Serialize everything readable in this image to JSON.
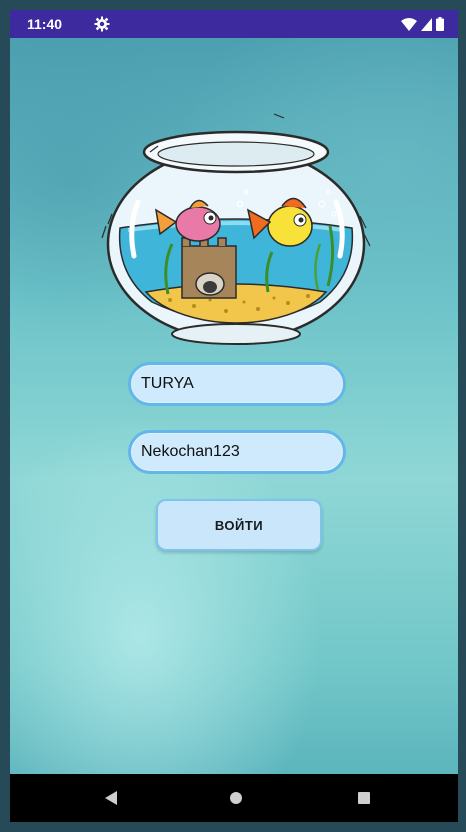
{
  "status_bar": {
    "time": "11:40",
    "icons": [
      "gear-icon",
      "wifi-icon",
      "signal-icon",
      "battery-icon"
    ]
  },
  "illustration": {
    "icon": "fishbowl-illustration"
  },
  "login_form": {
    "username_value": "TURYA",
    "password_value": "Nekochan123",
    "submit_label": "войти"
  },
  "nav_bar": {
    "icons": [
      "back-icon",
      "home-icon",
      "recents-icon"
    ]
  },
  "colors": {
    "status_bar": "#3d2a9e",
    "field_border": "#62b6ea",
    "field_fill": "#cfeafd",
    "button_fill": "#c9e6fb"
  }
}
